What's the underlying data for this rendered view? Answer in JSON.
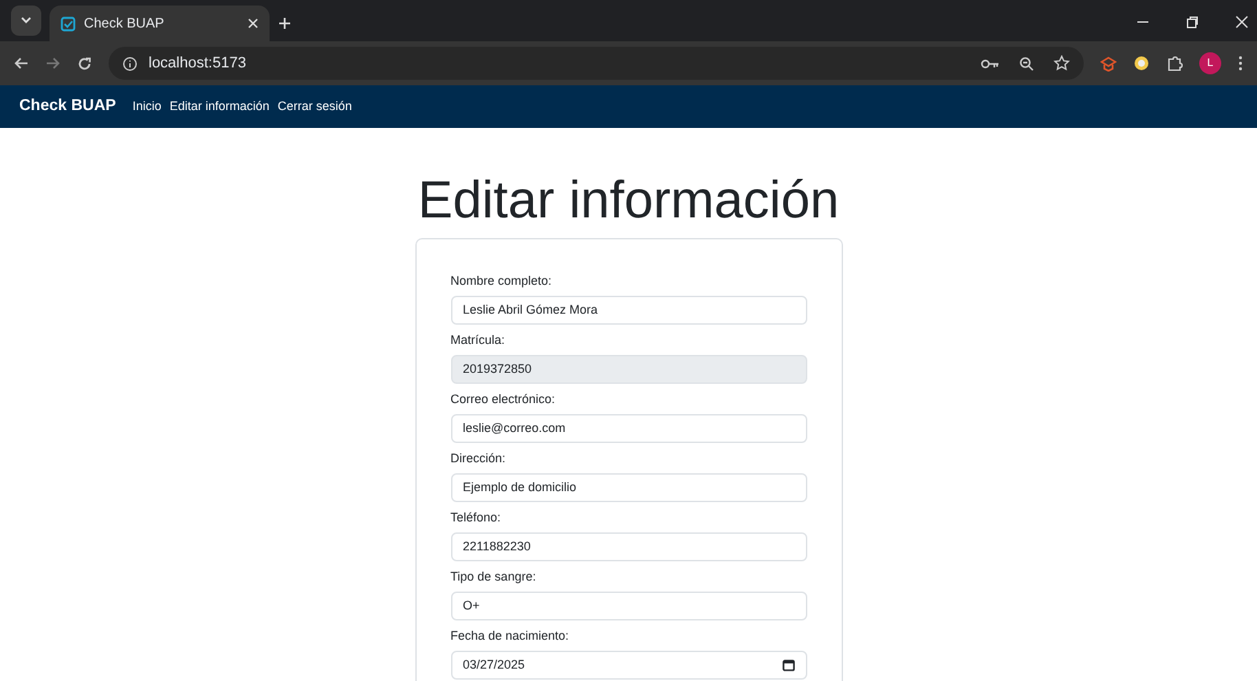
{
  "browser": {
    "tab": {
      "title": "Check BUAP",
      "selected": true
    },
    "address": "localhost:5173",
    "profile_initial": "L"
  },
  "navbar": {
    "brand": "Check BUAP",
    "links": [
      {
        "label": "Inicio"
      },
      {
        "label": "Editar información"
      },
      {
        "label": "Cerrar sesión"
      }
    ]
  },
  "page": {
    "title": "Editar información"
  },
  "form": {
    "fields": [
      {
        "label": "Nombre completo:",
        "value": "Leslie Abril Gómez Mora",
        "kind": "text",
        "disabled": false
      },
      {
        "label": "Matrícula:",
        "value": "2019372850",
        "kind": "text",
        "disabled": true
      },
      {
        "label": "Correo electrónico:",
        "value": "leslie@correo.com",
        "kind": "text",
        "disabled": false
      },
      {
        "label": "Dirección:",
        "value": "Ejemplo de domicilio",
        "kind": "text",
        "disabled": false
      },
      {
        "label": "Teléfono:",
        "value": "2211882230",
        "kind": "text",
        "disabled": false
      },
      {
        "label": "Tipo de sangre:",
        "value": "O+",
        "kind": "text",
        "disabled": false
      },
      {
        "label": "Fecha de nacimiento:",
        "value": "03/27/2025",
        "kind": "date",
        "disabled": false
      }
    ]
  }
}
